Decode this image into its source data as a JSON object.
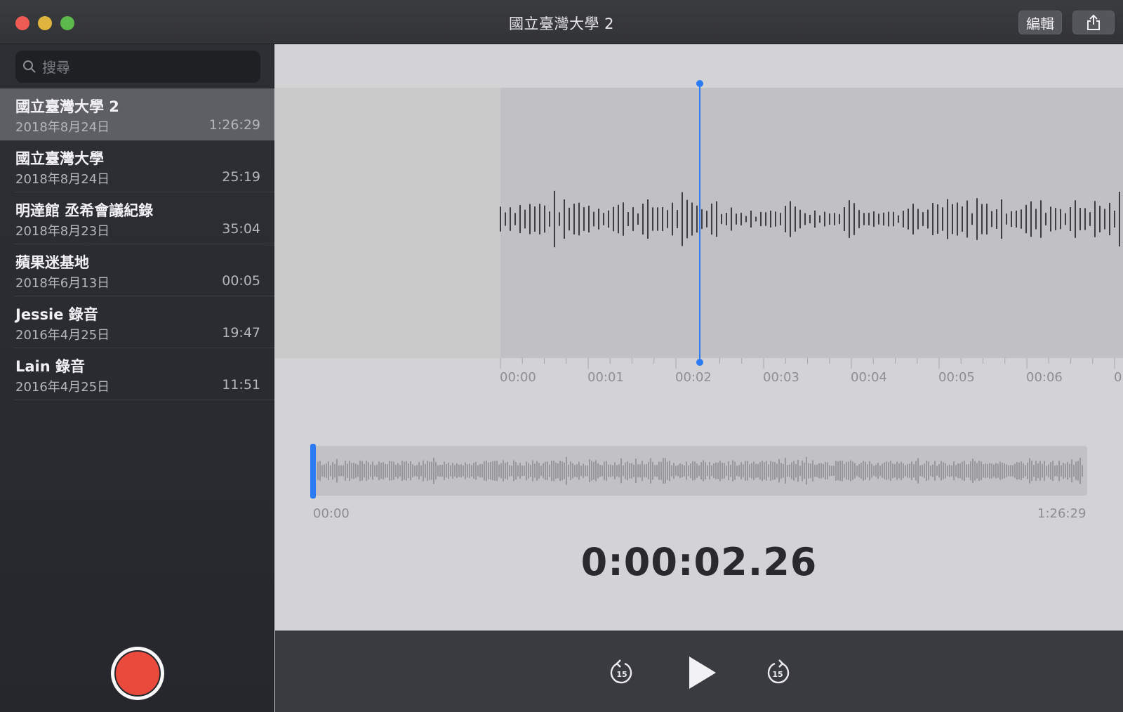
{
  "window": {
    "title": "國立臺灣大學 2",
    "edit_label": "編輯",
    "share_icon": "share-icon"
  },
  "search": {
    "placeholder": "搜尋"
  },
  "recordings": [
    {
      "name": "國立臺灣大學 2",
      "date": "2018年8月24日",
      "duration": "1:26:29",
      "selected": true
    },
    {
      "name": "國立臺灣大學",
      "date": "2018年8月24日",
      "duration": "25:19"
    },
    {
      "name": "明達館 丞希會議紀錄",
      "date": "2018年8月23日",
      "duration": "35:04"
    },
    {
      "name": "蘋果迷基地",
      "date": "2018年6月13日",
      "duration": "00:05"
    },
    {
      "name": "Jessie 錄音",
      "date": "2016年4月25日",
      "duration": "19:47"
    },
    {
      "name": "Lain 錄音",
      "date": "2016年4月25日",
      "duration": "11:51"
    }
  ],
  "timeline": {
    "ticks": [
      "00:00",
      "00:01",
      "00:02",
      "00:03",
      "00:04",
      "00:05",
      "00:06",
      "0"
    ]
  },
  "overview": {
    "start": "00:00",
    "end": "1:26:29"
  },
  "player": {
    "current_time": "0:00:02.26",
    "skip_back_label": "15",
    "skip_forward_label": "15"
  },
  "colors": {
    "accent": "#2b7bf2",
    "record": "#ea4a3b",
    "waveform": "#1e1e20"
  }
}
